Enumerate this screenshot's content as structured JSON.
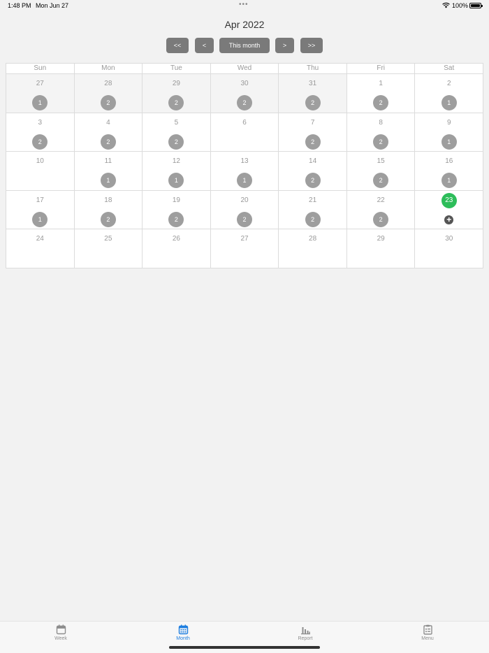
{
  "status": {
    "time": "1:48 PM",
    "date": "Mon Jun 27",
    "battery": "100%"
  },
  "header": {
    "title": "Apr 2022"
  },
  "nav": {
    "first": "<<",
    "prev": "<",
    "this_month": "This month",
    "next": ">",
    "last": ">>"
  },
  "weekdays": [
    "Sun",
    "Mon",
    "Tue",
    "Wed",
    "Thu",
    "Fri",
    "Sat"
  ],
  "weeks": [
    [
      {
        "day": "27",
        "count": "1",
        "other": true
      },
      {
        "day": "28",
        "count": "2",
        "other": true
      },
      {
        "day": "29",
        "count": "2",
        "other": true
      },
      {
        "day": "30",
        "count": "2",
        "other": true
      },
      {
        "day": "31",
        "count": "2",
        "other": true
      },
      {
        "day": "1",
        "count": "2"
      },
      {
        "day": "2",
        "count": "1"
      }
    ],
    [
      {
        "day": "3",
        "count": "2"
      },
      {
        "day": "4",
        "count": "2"
      },
      {
        "day": "5",
        "count": "2"
      },
      {
        "day": "6",
        "count": ""
      },
      {
        "day": "7",
        "count": "2"
      },
      {
        "day": "8",
        "count": "2"
      },
      {
        "day": "9",
        "count": "1"
      }
    ],
    [
      {
        "day": "10",
        "count": ""
      },
      {
        "day": "11",
        "count": "1"
      },
      {
        "day": "12",
        "count": "1"
      },
      {
        "day": "13",
        "count": "1"
      },
      {
        "day": "14",
        "count": "2"
      },
      {
        "day": "15",
        "count": "2"
      },
      {
        "day": "16",
        "count": "1"
      }
    ],
    [
      {
        "day": "17",
        "count": "1"
      },
      {
        "day": "18",
        "count": "2"
      },
      {
        "day": "19",
        "count": "2"
      },
      {
        "day": "20",
        "count": "2"
      },
      {
        "day": "21",
        "count": "2"
      },
      {
        "day": "22",
        "count": "2"
      },
      {
        "day": "23",
        "count": "",
        "today": true
      }
    ],
    [
      {
        "day": "24",
        "count": ""
      },
      {
        "day": "25",
        "count": ""
      },
      {
        "day": "26",
        "count": ""
      },
      {
        "day": "27",
        "count": ""
      },
      {
        "day": "28",
        "count": ""
      },
      {
        "day": "29",
        "count": ""
      },
      {
        "day": "30",
        "count": ""
      }
    ]
  ],
  "tabs": [
    {
      "label": "Week",
      "icon": "calendar-icon"
    },
    {
      "label": "Month",
      "icon": "calendar-grid-icon",
      "active": true
    },
    {
      "label": "Report",
      "icon": "bar-chart-icon"
    },
    {
      "label": "Menu",
      "icon": "clipboard-list-icon"
    }
  ],
  "colors": {
    "accent": "#1f7fe0",
    "today": "#2dbd5a",
    "badge": "#9e9e9e",
    "button": "#7a7a7a"
  }
}
